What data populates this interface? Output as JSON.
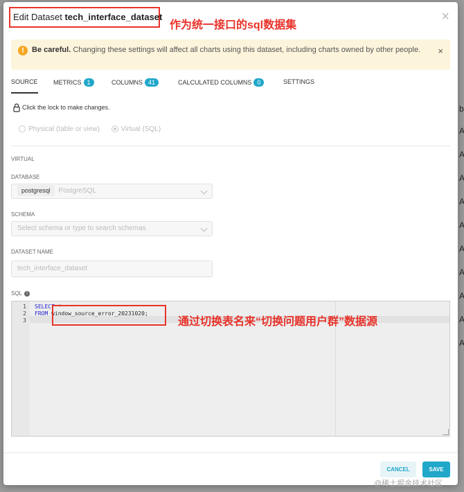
{
  "background": {
    "column_label": "by",
    "cells": [
      "A",
      "A",
      "A",
      "A",
      "A",
      "A",
      "A",
      "A",
      "A",
      "A"
    ]
  },
  "modal": {
    "title_prefix": "Edit Dataset",
    "title_dataset": "tech_interface_dataset",
    "close": "×"
  },
  "annotations": {
    "title_note": "作为统一接口的sql数据集",
    "sql_note": "通过切换表名来“切换问题用户群”数据源"
  },
  "warning": {
    "icon": "!",
    "bold": "Be careful.",
    "text": "Changing these settings will affect all charts using this dataset, including charts owned by other people.",
    "close": "×"
  },
  "tabs": [
    {
      "label": "Source",
      "badge": ""
    },
    {
      "label": "Metrics",
      "badge": "1"
    },
    {
      "label": "Columns",
      "badge": "41"
    },
    {
      "label": "Calculated columns",
      "badge": "0"
    },
    {
      "label": "Settings",
      "badge": ""
    }
  ],
  "lock": {
    "text": "Click the lock to make changes."
  },
  "dataset_type": {
    "physical": "Physical (table or view)",
    "virtual": "Virtual (SQL)"
  },
  "virtual_section": "VIRTUAL",
  "database": {
    "label": "DATABASE",
    "tag": "postgresql",
    "value": "PostgreSQL"
  },
  "schema": {
    "label": "SCHEMA",
    "placeholder": "Select schema or type to search schemas"
  },
  "dataset_name": {
    "label": "DATASET NAME",
    "value": "tech_interface_dataset"
  },
  "sql": {
    "label": "SQL",
    "info_icon": "i",
    "line_numbers": [
      "1",
      "2",
      "3"
    ],
    "line1_keyword": "SELECT",
    "line1_rest": " *",
    "line2_keyword": "FROM",
    "line2_rest": " window_source_error_20231020;"
  },
  "buttons": {
    "cancel": "Cancel",
    "save": "Save"
  },
  "watermark": "@稀土掘金技术社区",
  "colors": {
    "accent": "#20a7c9",
    "annotation_red": "#e8322a",
    "warning_bg": "#fdf4dc"
  }
}
